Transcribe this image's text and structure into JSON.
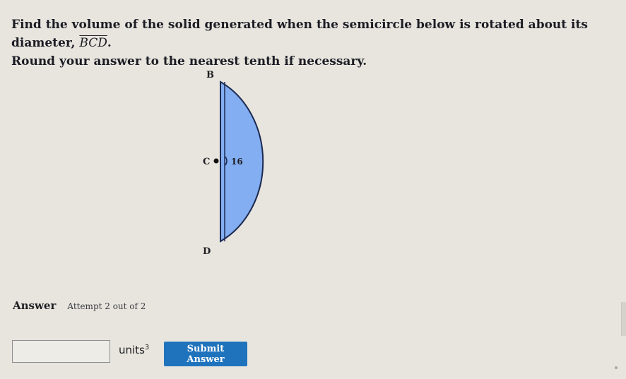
{
  "question": {
    "line1_prefix": "Find the volume of the solid generated when the semicircle below is rotated about its diameter, ",
    "diameter_name": "BCD",
    "line1_suffix": ".",
    "line2": "Round your answer to the nearest tenth if necessary."
  },
  "figure": {
    "label_top": "B",
    "label_center": "C",
    "label_bottom": "D",
    "radius_label": "16",
    "fill_color": "#83aef2",
    "stroke_color": "#1d2a52"
  },
  "answer": {
    "label": "Answer",
    "attempt_text": "Attempt 2 out of 2",
    "input_value": "",
    "units_text": "units",
    "units_exponent": "3",
    "submit_label": "Submit Answer"
  },
  "colors": {
    "background": "#e7e5de",
    "submit_button": "#1f73bd"
  }
}
